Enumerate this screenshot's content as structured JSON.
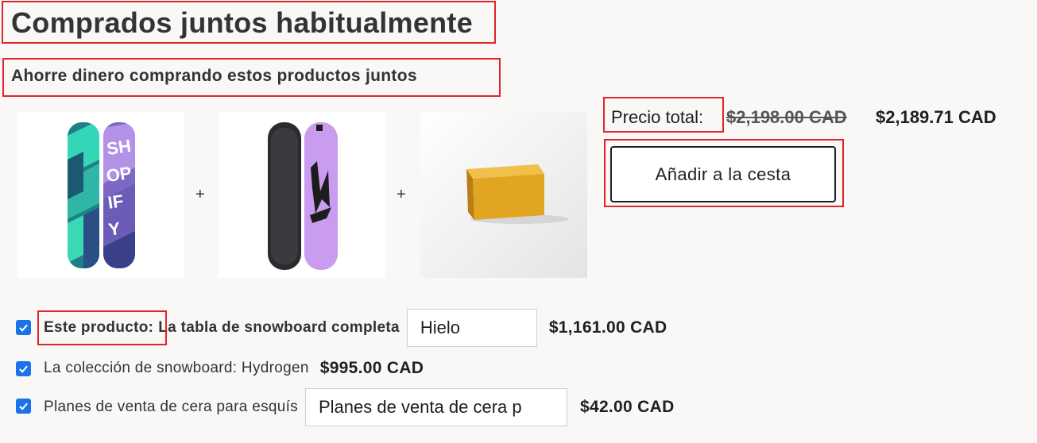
{
  "header": {
    "title": "Comprados juntos habitualmente",
    "subtitle": "Ahorre dinero comprando estos productos juntos"
  },
  "bundle": {
    "separator": "+",
    "total_label": "Precio total:",
    "original_price": "$2,198.00 CAD",
    "discounted_price": "$2,189.71 CAD",
    "add_button_label": "Añadir a la cesta"
  },
  "products": [
    {
      "checked": true,
      "prefix": "Este producto:",
      "name": "La tabla de snowboard completa",
      "variant": "Hielo",
      "price": "$1,161.00 CAD"
    },
    {
      "checked": true,
      "name": "La colección de snowboard: Hydrogen",
      "price": "$995.00 CAD"
    },
    {
      "checked": true,
      "name": "Planes de venta de cera para esquís",
      "variant": "Planes de venta de cera p",
      "price": "$42.00 CAD"
    }
  ],
  "colors": {
    "highlight": "#e0242b",
    "checkbox": "#1a73e8",
    "board1_teal": "#2fd3b4",
    "board1_purple": "#9a7fd1",
    "board2_lilac": "#c79af0",
    "wax": "#e2a521"
  }
}
